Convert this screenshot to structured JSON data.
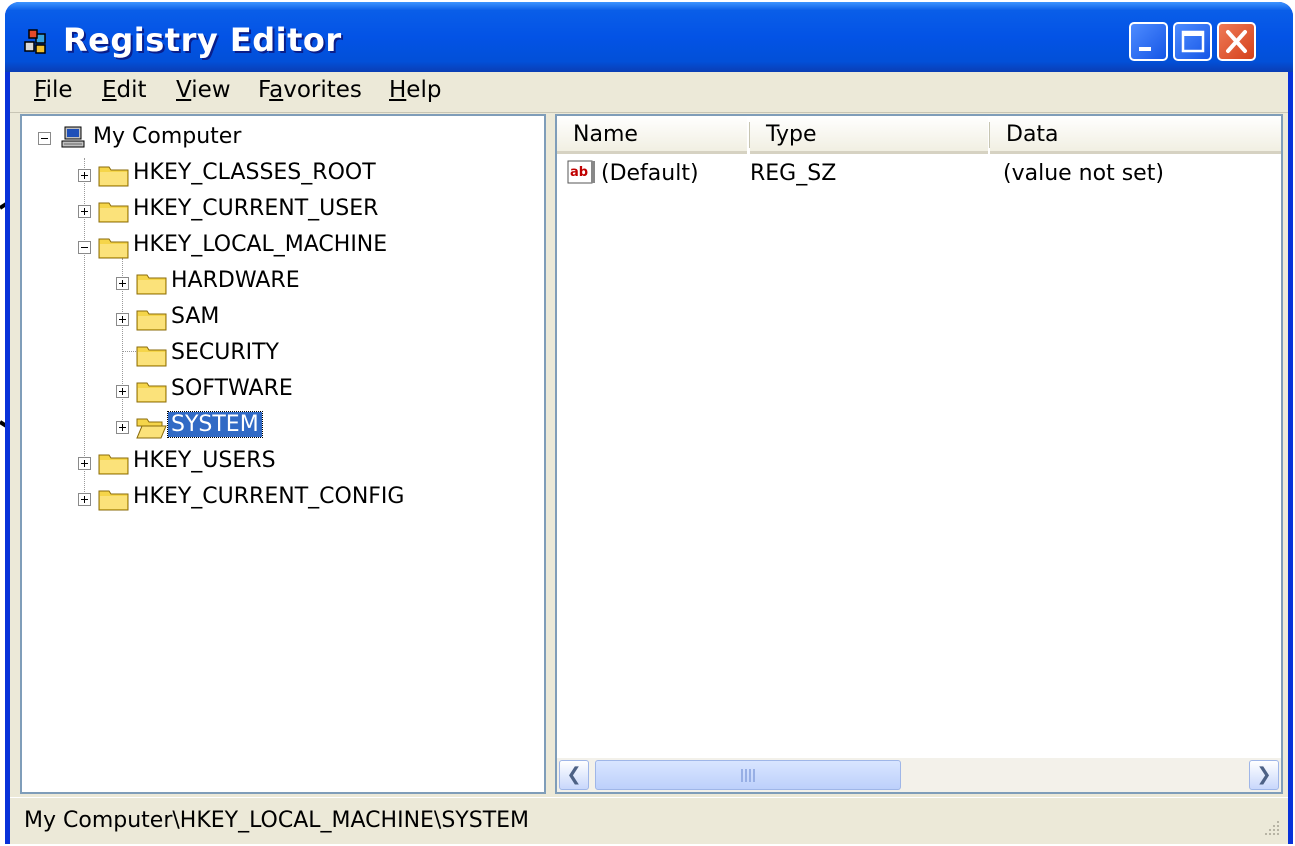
{
  "window": {
    "title": "Registry Editor",
    "buttons": {
      "minimize": "minimize",
      "maximize": "maximize",
      "close": "close"
    }
  },
  "menubar": {
    "items": [
      {
        "label": "File",
        "mnemonic": "F"
      },
      {
        "label": "Edit",
        "mnemonic": "E"
      },
      {
        "label": "View",
        "mnemonic": "V"
      },
      {
        "label": "Favorites",
        "mnemonic": "a"
      },
      {
        "label": "Help",
        "mnemonic": "H"
      }
    ]
  },
  "tree": {
    "root": "My Computer",
    "hives": [
      {
        "label": "HKEY_CLASSES_ROOT",
        "expandable": true,
        "expanded": false
      },
      {
        "label": "HKEY_CURRENT_USER",
        "expandable": true,
        "expanded": false
      },
      {
        "label": "HKEY_LOCAL_MACHINE",
        "expandable": true,
        "expanded": true
      },
      {
        "label": "HKEY_USERS",
        "expandable": true,
        "expanded": false
      },
      {
        "label": "HKEY_CURRENT_CONFIG",
        "expandable": true,
        "expanded": false
      }
    ],
    "hklm_children": [
      {
        "label": "HARDWARE",
        "expandable": true
      },
      {
        "label": "SAM",
        "expandable": true
      },
      {
        "label": "SECURITY",
        "expandable": false
      },
      {
        "label": "SOFTWARE",
        "expandable": true
      },
      {
        "label": "SYSTEM",
        "expandable": true,
        "selected": true
      }
    ]
  },
  "list": {
    "columns": [
      "Name",
      "Type",
      "Data"
    ],
    "rows": [
      {
        "name": "(Default)",
        "type": "REG_SZ",
        "data": "(value not set)",
        "icon": "string-value-icon"
      }
    ]
  },
  "statusbar": {
    "path": "My Computer\\HKEY_LOCAL_MACHINE\\SYSTEM"
  },
  "colors": {
    "titlebar": "#0353e6",
    "selection": "#316ac5",
    "close_button": "#d5411b",
    "chrome": "#ece9d8",
    "folder": "#f5d54a"
  },
  "icons": {
    "app": "registry-editor-icon",
    "root": "computer-icon",
    "folder": "folder-icon",
    "open_folder": "open-folder-icon"
  }
}
